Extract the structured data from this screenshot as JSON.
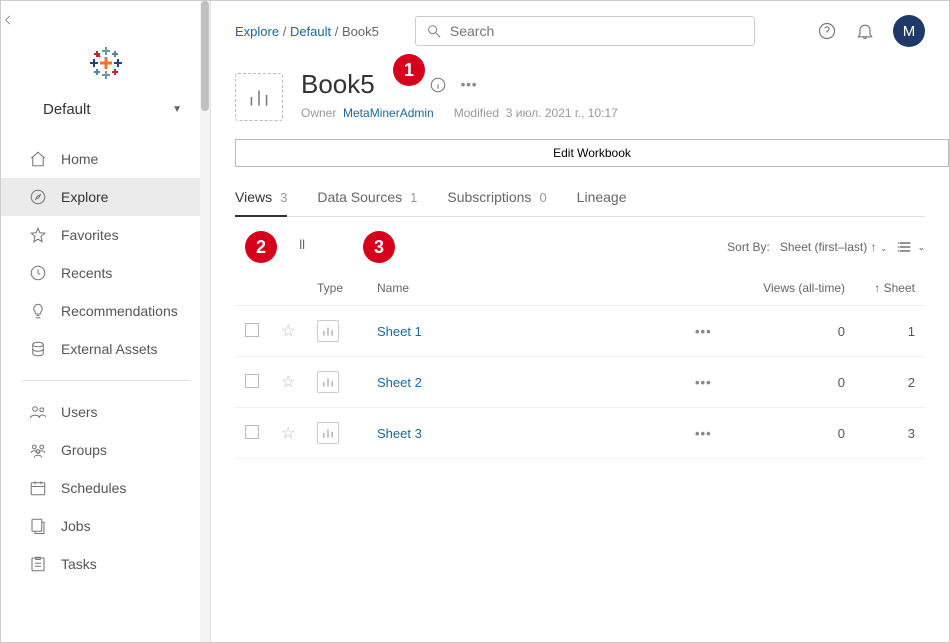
{
  "sidebar": {
    "site": "Default",
    "nav": [
      {
        "label": "Home"
      },
      {
        "label": "Explore"
      },
      {
        "label": "Favorites"
      },
      {
        "label": "Recents"
      },
      {
        "label": "Recommendations"
      },
      {
        "label": "External Assets"
      }
    ],
    "admin": [
      {
        "label": "Users"
      },
      {
        "label": "Groups"
      },
      {
        "label": "Schedules"
      },
      {
        "label": "Jobs"
      },
      {
        "label": "Tasks"
      }
    ]
  },
  "breadcrumb": {
    "root": "Explore",
    "project": "Default",
    "current": "Book5"
  },
  "search": {
    "placeholder": "Search"
  },
  "avatar": {
    "initial": "M"
  },
  "workbook": {
    "title": "Book5",
    "owner_label": "Owner",
    "owner_name": "MetaMinerAdmin",
    "modified_label": "Modified",
    "modified_value": "3 июл. 2021 г., 10:17",
    "edit_label": "Edit Workbook"
  },
  "tabs": [
    {
      "label": "Views",
      "count": "3"
    },
    {
      "label": "Data Sources",
      "count": "1"
    },
    {
      "label": "Subscriptions",
      "count": "0"
    },
    {
      "label": "Lineage",
      "count": ""
    }
  ],
  "toolbar": {
    "select_all_hint": "ll",
    "sort_label": "Sort By:",
    "sort_value": "Sheet (first–last) ↑"
  },
  "table": {
    "headers": {
      "type": "Type",
      "name": "Name",
      "views": "Views (all-time)",
      "sheet": "↑ Sheet"
    },
    "rows": [
      {
        "name": "Sheet 1",
        "views": "0",
        "sheet": "1"
      },
      {
        "name": "Sheet 2",
        "views": "0",
        "sheet": "2"
      },
      {
        "name": "Sheet 3",
        "views": "0",
        "sheet": "3"
      }
    ]
  },
  "annotations": {
    "a1": "1",
    "a2": "2",
    "a3": "3"
  }
}
